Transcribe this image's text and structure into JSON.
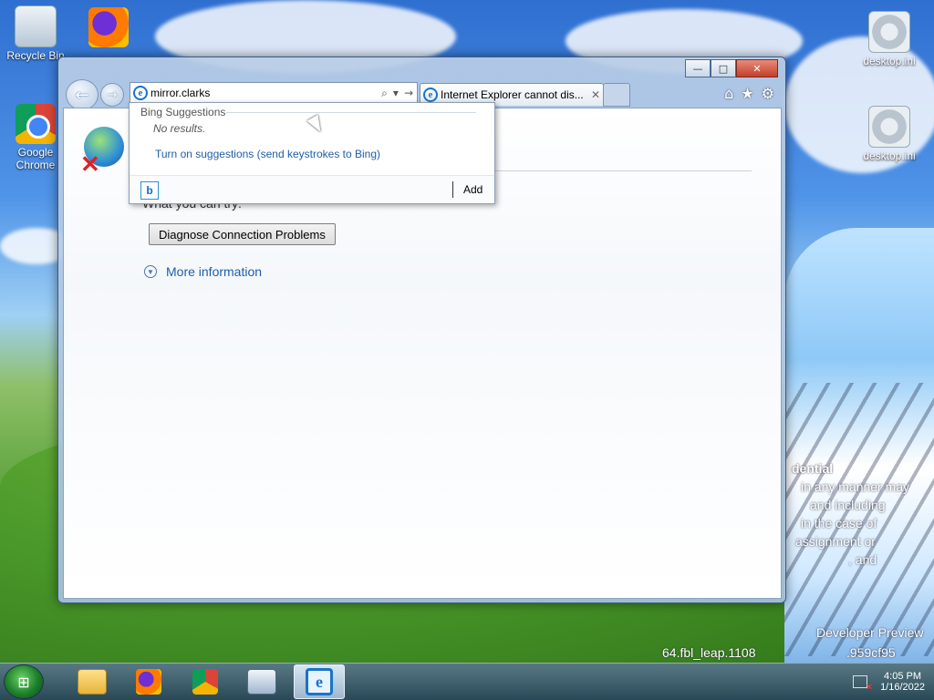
{
  "desktop": {
    "icons": [
      {
        "label": "Recycle Bin"
      },
      {
        "label": "Google Chrome"
      },
      {
        "label": "desktop.ini"
      },
      {
        "label": "desktop.ini"
      }
    ],
    "overlay_texts": [
      "dential",
      "in any manner may",
      "and including",
      "in the case of",
      "assignment or",
      ", and",
      "Developer Preview",
      "64.fbl_leap.1108",
      ".959cf95"
    ]
  },
  "browser": {
    "address_value": "mirror.clarks",
    "tab_title": "Internet Explorer cannot dis...",
    "tab_close": "✕",
    "window_controls": {
      "minimize": "—",
      "maximize": "□",
      "close": "✕"
    },
    "page": {
      "partial_line": "What you can try:",
      "diagnose_button": "Diagnose Connection Problems",
      "more_info": "More information"
    },
    "suggestions": {
      "header": "Bing Suggestions",
      "no_results": "No results.",
      "turn_on": "Turn on suggestions (send keystrokes to Bing)",
      "add": "Add",
      "bing_icon": "b"
    }
  },
  "taskbar": {
    "time": "4:05 PM",
    "date": "1/16/2022"
  }
}
